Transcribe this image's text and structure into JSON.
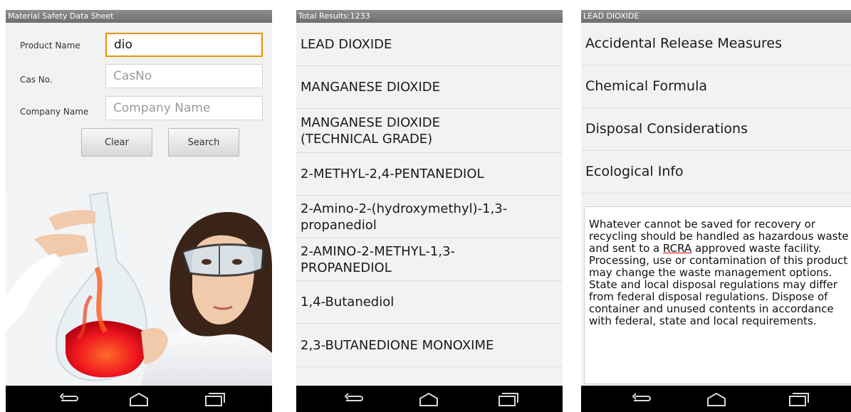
{
  "screen1": {
    "title": "Material Safety Data Sheet",
    "product_label": "Product Name",
    "product_value": "dio",
    "cas_label": "Cas No.",
    "cas_placeholder": "CasNo",
    "company_label": "Company Name",
    "company_placeholder": "Company Name",
    "clear_label": "Clear",
    "search_label": "Search"
  },
  "screen2": {
    "title": "Total Results:1233",
    "items": [
      "LEAD DIOXIDE",
      "MANGANESE DIOXIDE",
      "MANGANESE DIOXIDE\n(TECHNICAL GRADE)",
      "2-METHYL-2,4-PENTANEDIOL",
      "2-Amino-2-(hydroxymethyl)-1,3-\npropanediol",
      "2-AMINO-2-METHYL-1,3-\nPROPANEDIOL",
      "1,4-Butanediol",
      "2,3-BUTANEDIONE MONOXIME"
    ]
  },
  "screen3": {
    "title": "LEAD DIOXIDE",
    "sections": [
      "Accidental Release Measures",
      "Chemical Formula",
      "Disposal Considerations",
      "Ecological Info"
    ],
    "disposal_text_before": "Whatever cannot be saved for recovery or recycling should be handled as hazardous waste and sent to a ",
    "disposal_link": "RCRA",
    "disposal_text_after": " approved waste facility. Processing, use or contamination of this product may change the waste management options. State and local disposal regulations may differ from federal disposal regulations.  Dispose of container and unused contents in accordance with federal, state and local requirements."
  },
  "navbar": {
    "icons": [
      "back-icon",
      "home-icon",
      "recent-apps-icon"
    ]
  }
}
